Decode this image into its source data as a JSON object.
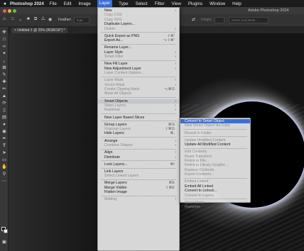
{
  "menubar": {
    "apple": "",
    "app_name": "Photoshop 2024",
    "items": [
      "File",
      "Edit",
      "Image",
      "Layer",
      "Type",
      "Select",
      "Filter",
      "View",
      "Plugins",
      "Window",
      "Help"
    ]
  },
  "window": {
    "title": "Adobe Photoshop 2024"
  },
  "options_bar": {
    "feather_label": "Feather:",
    "feather_value": "0 px",
    "width_label": "Height:",
    "select_mask_label": "Select and Mask..."
  },
  "document": {
    "tab_label": "Untitled-1 @ 25% (RGB/16*) *"
  },
  "layer_menu": {
    "items": [
      {
        "label": "New",
        "arrow": "›",
        "disabled": false
      },
      {
        "label": "Copy CSS",
        "disabled": true
      },
      {
        "label": "Copy SVG",
        "disabled": true
      },
      {
        "label": "Duplicate Layers...",
        "disabled": false
      },
      {
        "label": "Delete",
        "arrow": "›",
        "disabled": true
      },
      {
        "sep": true
      },
      {
        "label": "Quick Export as PNG",
        "shortcut": "⇧⌘'",
        "disabled": false
      },
      {
        "label": "Export As...",
        "shortcut": "⌥⇧⌘'",
        "disabled": false
      },
      {
        "sep": true
      },
      {
        "label": "Rename Layer...",
        "disabled": false
      },
      {
        "label": "Layer Style",
        "arrow": "›",
        "disabled": false
      },
      {
        "label": "Smart Filter",
        "arrow": "›",
        "disabled": true
      },
      {
        "sep": true
      },
      {
        "label": "New Fill Layer",
        "arrow": "›",
        "disabled": false
      },
      {
        "label": "New Adjustment Layer",
        "arrow": "›",
        "disabled": false
      },
      {
        "label": "Layer Content Options...",
        "disabled": true
      },
      {
        "sep": true
      },
      {
        "label": "Layer Mask",
        "arrow": "›",
        "disabled": true
      },
      {
        "label": "Vector Mask",
        "arrow": "›",
        "disabled": true
      },
      {
        "label": "Create Clipping Mask",
        "shortcut": "⌥⌘G",
        "disabled": true
      },
      {
        "label": "Mask All Objects",
        "disabled": true
      },
      {
        "sep": true
      },
      {
        "label": "Smart Objects",
        "arrow": "›",
        "disabled": false,
        "highlighted": true
      },
      {
        "label": "Video Layers",
        "arrow": "›",
        "disabled": true
      },
      {
        "label": "Rasterize",
        "arrow": "›",
        "disabled": true
      },
      {
        "sep": true
      },
      {
        "label": "New Layer Based Slices",
        "disabled": false
      },
      {
        "sep": true
      },
      {
        "label": "Group Layers",
        "shortcut": "⌘G",
        "disabled": false
      },
      {
        "label": "Ungroup Layers",
        "shortcut": "⇧⌘G",
        "disabled": true
      },
      {
        "label": "Hide Layers",
        "shortcut": "⌘,",
        "disabled": false
      },
      {
        "sep": true
      },
      {
        "label": "Arrange",
        "arrow": "›",
        "disabled": false
      },
      {
        "label": "Combine Shapes",
        "arrow": "›",
        "disabled": true
      },
      {
        "sep": true
      },
      {
        "label": "Align",
        "arrow": "›",
        "disabled": false
      },
      {
        "label": "Distribute",
        "arrow": "›",
        "disabled": false
      },
      {
        "sep": true
      },
      {
        "label": "Lock Layers...",
        "shortcut": "⌘/",
        "disabled": false
      },
      {
        "sep": true
      },
      {
        "label": "Link Layers",
        "disabled": false
      },
      {
        "label": "Select Linked Layers",
        "disabled": true
      },
      {
        "sep": true
      },
      {
        "label": "Merge Layers",
        "shortcut": "⌘E",
        "disabled": false
      },
      {
        "label": "Merge Visible",
        "shortcut": "⇧⌘E",
        "disabled": false
      },
      {
        "label": "Flatten Image",
        "disabled": false
      },
      {
        "sep": true
      },
      {
        "label": "Matting",
        "arrow": "›",
        "disabled": true
      }
    ]
  },
  "smart_objects_submenu": {
    "items": [
      {
        "label": "Convert to Smart Object",
        "selected": true,
        "disabled": false
      },
      {
        "label": "New Smart Object via Copy",
        "disabled": true
      },
      {
        "sep": true
      },
      {
        "label": "Reveal in Finder",
        "disabled": true
      },
      {
        "sep": true
      },
      {
        "label": "Update Modified Content",
        "disabled": true
      },
      {
        "label": "Update All Modified Content",
        "disabled": false
      },
      {
        "sep": true
      },
      {
        "label": "Edit Contents",
        "disabled": true
      },
      {
        "label": "Reset Transform",
        "disabled": true
      },
      {
        "label": "Relink to File...",
        "disabled": true
      },
      {
        "label": "Relink to Library Graphic...",
        "disabled": true
      },
      {
        "label": "Replace Contents...",
        "disabled": true
      },
      {
        "label": "Export Contents...",
        "disabled": true
      },
      {
        "sep": true
      },
      {
        "label": "Embed Linked",
        "disabled": true
      },
      {
        "label": "Embed All Linked",
        "disabled": false
      },
      {
        "label": "Convert to Linked...",
        "disabled": false
      },
      {
        "label": "Convert to Layers",
        "disabled": true
      },
      {
        "sep": true
      },
      {
        "label": "Stack Mode",
        "arrow": "›",
        "disabled": true
      },
      {
        "label": "Rasterize",
        "disabled": true
      }
    ]
  },
  "tools": [
    "move-icon",
    "marquee-icon",
    "lasso-icon",
    "quick-select-icon",
    "crop-icon",
    "frame-icon",
    "eyedropper-icon",
    "healing-icon",
    "brush-icon",
    "stamp-icon",
    "history-brush-icon",
    "eraser-icon",
    "gradient-icon",
    "blur-icon",
    "dodge-icon",
    "pen-icon",
    "type-icon",
    "path-select-icon",
    "shape-icon",
    "hand-icon",
    "zoom-icon",
    "more-icon"
  ],
  "colors": {
    "menu_bg": "#dedede",
    "selected_bg": "#3b6fd6",
    "app_bg": "#2b2b2b"
  }
}
